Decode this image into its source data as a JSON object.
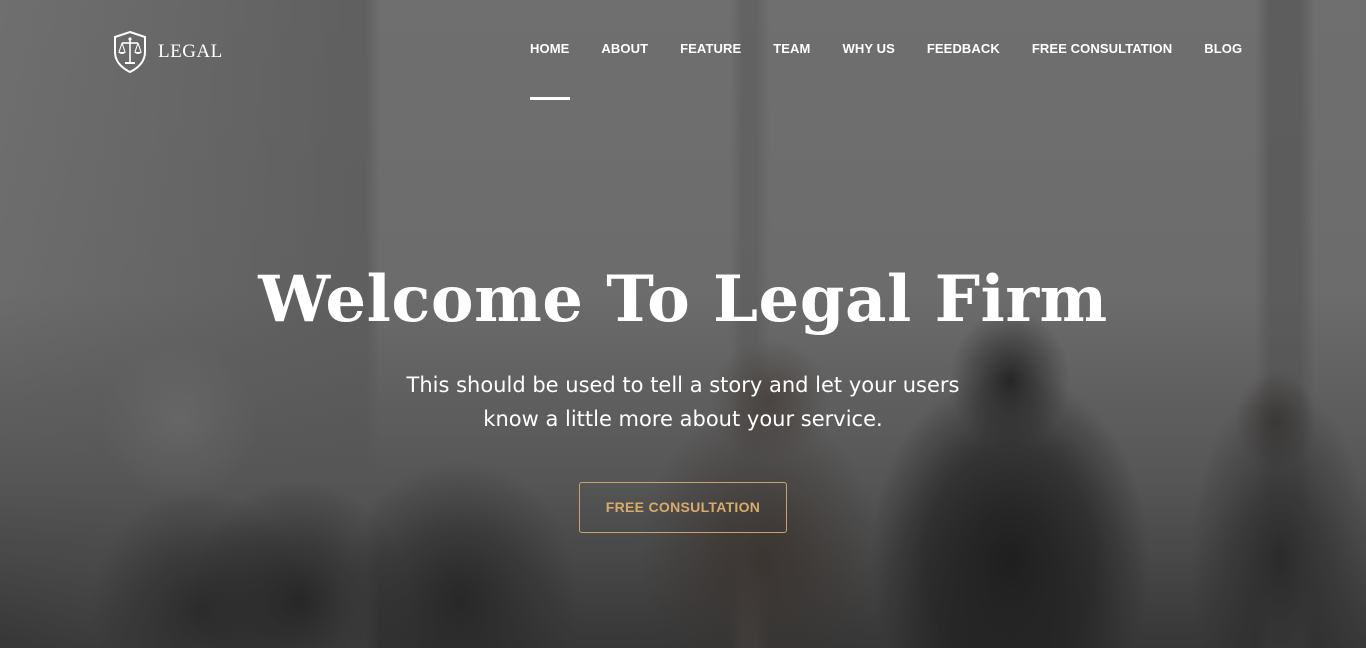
{
  "brand": {
    "name": "LEGAL",
    "icon": "scales-shield-icon"
  },
  "nav": {
    "items": [
      {
        "label": "HOME",
        "active": true
      },
      {
        "label": "ABOUT",
        "active": false
      },
      {
        "label": "FEATURE",
        "active": false
      },
      {
        "label": "TEAM",
        "active": false
      },
      {
        "label": "WHY US",
        "active": false
      },
      {
        "label": "FEEDBACK",
        "active": false
      },
      {
        "label": "FREE CONSULTATION",
        "active": false
      },
      {
        "label": "BLOG",
        "active": false
      }
    ]
  },
  "hero": {
    "title": "Welcome To Legal Firm",
    "subtitle": "This should be used to tell a story and let your users know a little more about your service.",
    "cta_label": "FREE CONSULTATION"
  },
  "colors": {
    "accent": "#d7ac6b",
    "text": "#ffffff",
    "overlay": "#6b6b6b"
  }
}
